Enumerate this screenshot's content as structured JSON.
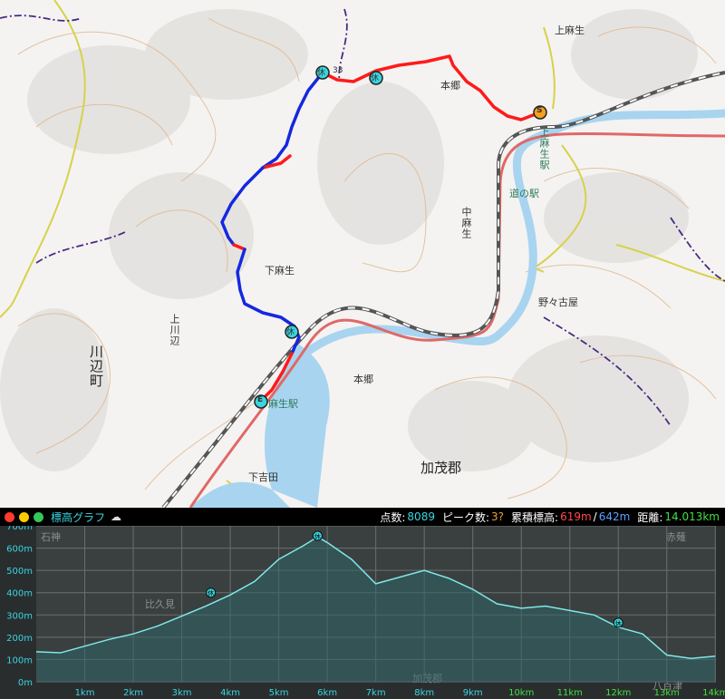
{
  "map": {
    "labels": {
      "kami_aso": "上麻生",
      "hongo_n": "本郷",
      "kami_aso_eki": "上麻生駅",
      "michi_no_eki": "道の駅",
      "naka_aso": "中麻生",
      "shimo_aso": "下麻生",
      "kami_kawabe": "上川辺",
      "kawabe_cho": "川辺町",
      "nonogoya": "野々古屋",
      "hongo_s": "本郷",
      "kamo_gun": "加茂郡",
      "shimo_yoshida": "下吉田",
      "aso_eki": "麻生駅",
      "summit_num": "33"
    },
    "markers": {
      "start": "S",
      "end": "E",
      "rest": "休"
    },
    "colors": {
      "route_up": "#ff1a1a",
      "route_down": "#1428e0",
      "river": "#a8d4f0",
      "railway": "#555555",
      "highway": "#e06868",
      "contour": "#e0b48c"
    }
  },
  "graph": {
    "title": "標高グラフ",
    "cloud_icon": "cloud-icon",
    "stats": {
      "points_label": "点数:",
      "points_value": "8089",
      "peaks_label": "ピーク数:",
      "peaks_value": "3?",
      "gain_label": "累積標高:",
      "gain_up": "619m",
      "gain_sep": "/",
      "gain_down": "642m",
      "distance_label": "距離:",
      "distance_value": "14.013km"
    },
    "bg_labels": {
      "ishigami": "石神",
      "hisami": "比久見",
      "kamo": "加茂郡",
      "yaotsu": "八百津",
      "akahane": "赤薙"
    },
    "rest_marker": "休"
  },
  "chart_data": {
    "type": "area",
    "title": "標高グラフ",
    "xlabel": "",
    "ylabel": "",
    "xlim": [
      0,
      14.013
    ],
    "ylim": [
      0,
      700
    ],
    "x_ticks": [
      "1km",
      "2km",
      "3km",
      "4km",
      "5km",
      "6km",
      "7km",
      "8km",
      "9km",
      "10km",
      "11km",
      "12km",
      "13km",
      "14km"
    ],
    "y_ticks": [
      "0m",
      "100m",
      "200m",
      "300m",
      "400m",
      "500m",
      "600m",
      "700m"
    ],
    "series": [
      {
        "x": [
          0,
          0.5,
          1,
          1.5,
          2,
          2.5,
          3,
          3.5,
          4,
          4.5,
          5,
          5.5,
          5.8,
          6,
          6.5,
          7,
          7.5,
          8,
          8.5,
          9,
          9.5,
          10,
          10.5,
          11,
          11.5,
          12,
          12.5,
          13,
          13.5,
          14
        ],
        "values": [
          135,
          130,
          160,
          190,
          215,
          250,
          295,
          340,
          390,
          450,
          550,
          610,
          650,
          625,
          550,
          440,
          470,
          500,
          465,
          415,
          350,
          330,
          340,
          320,
          300,
          245,
          215,
          120,
          105,
          115
        ]
      }
    ],
    "markers": [
      {
        "x": 3.6,
        "y": 400,
        "label": "休"
      },
      {
        "x": 5.8,
        "y": 655,
        "label": "休"
      },
      {
        "x": 12.0,
        "y": 265,
        "label": "休"
      }
    ],
    "grid": true
  }
}
